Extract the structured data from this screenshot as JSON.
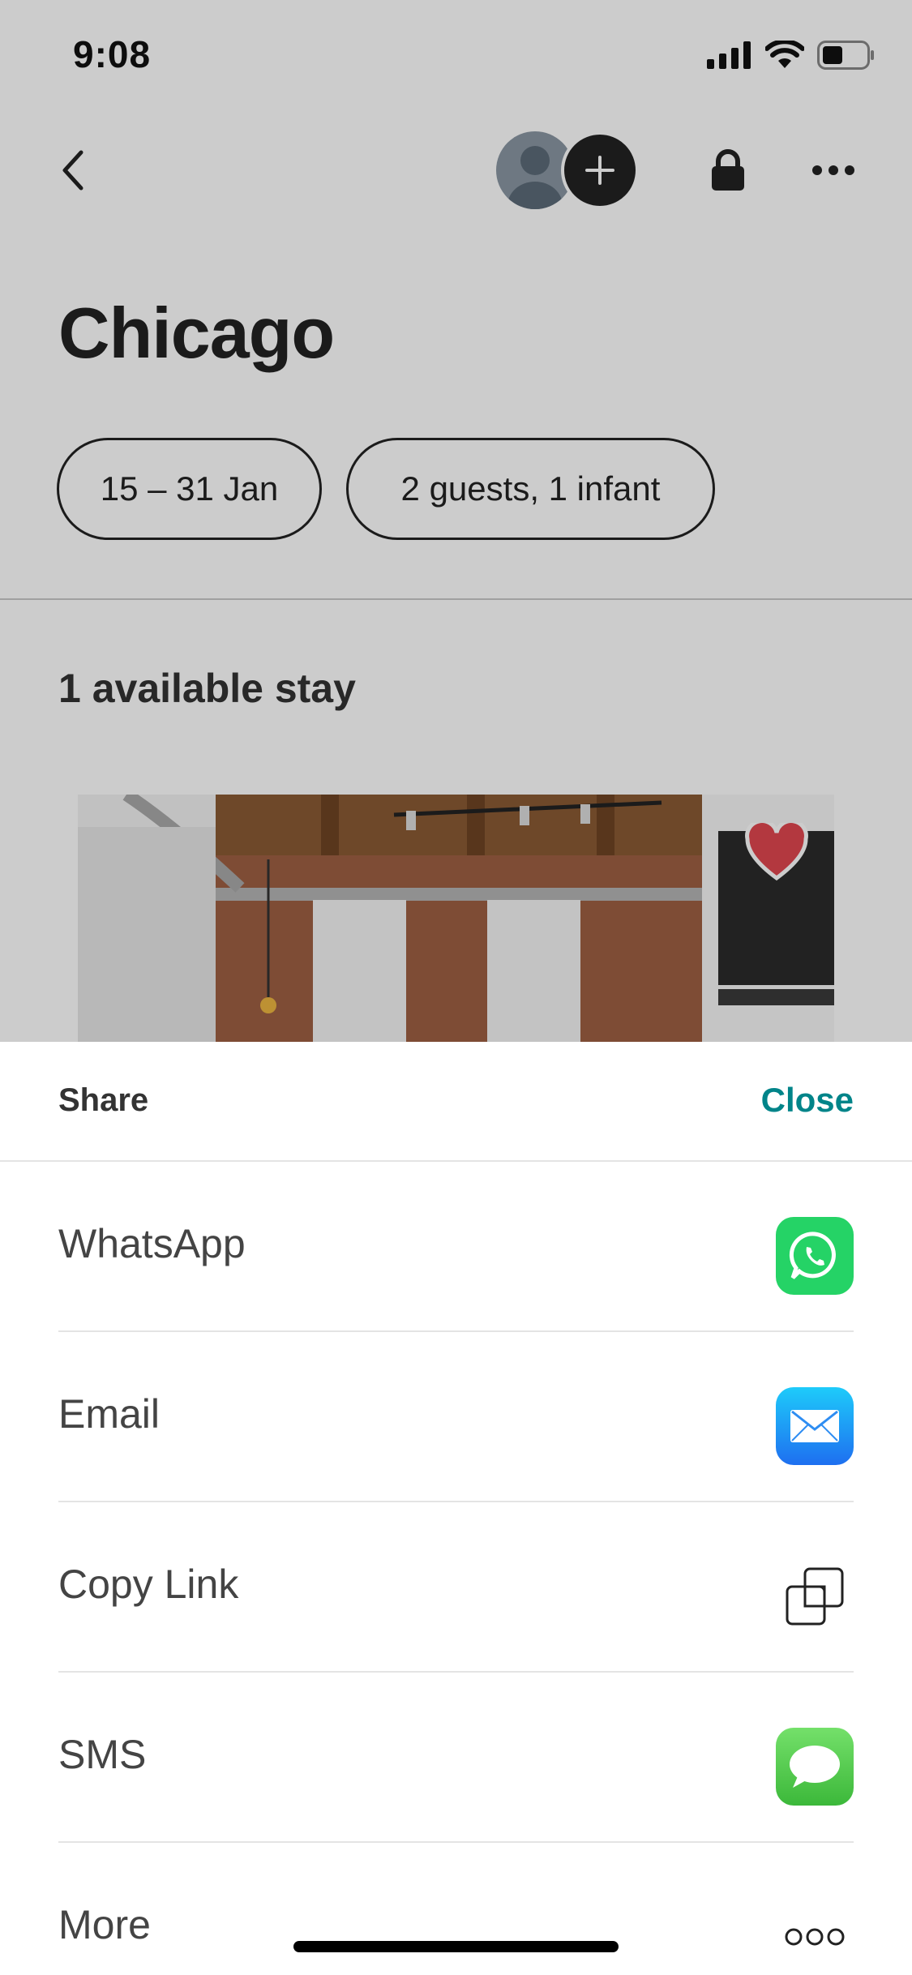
{
  "status_bar": {
    "time": "9:08"
  },
  "header": {
    "title": "Chicago"
  },
  "filters": {
    "dates": "15 – 31 Jan",
    "guests": "2 guests, 1 infant"
  },
  "results": {
    "count_label": "1 available stay"
  },
  "share_sheet": {
    "title": "Share",
    "close_label": "Close",
    "options": [
      {
        "label": "WhatsApp",
        "icon": "whatsapp-icon",
        "color": "#25D366"
      },
      {
        "label": "Email",
        "icon": "mail-icon",
        "color": "#1E8CF0"
      },
      {
        "label": "Copy Link",
        "icon": "copy-icon",
        "color": "#222222"
      },
      {
        "label": "SMS",
        "icon": "message-icon",
        "color": "#5FD15A"
      },
      {
        "label": "More",
        "icon": "more-icon",
        "color": "#222222"
      }
    ]
  },
  "colors": {
    "accent": "#008489",
    "heart": "#E0474F"
  }
}
